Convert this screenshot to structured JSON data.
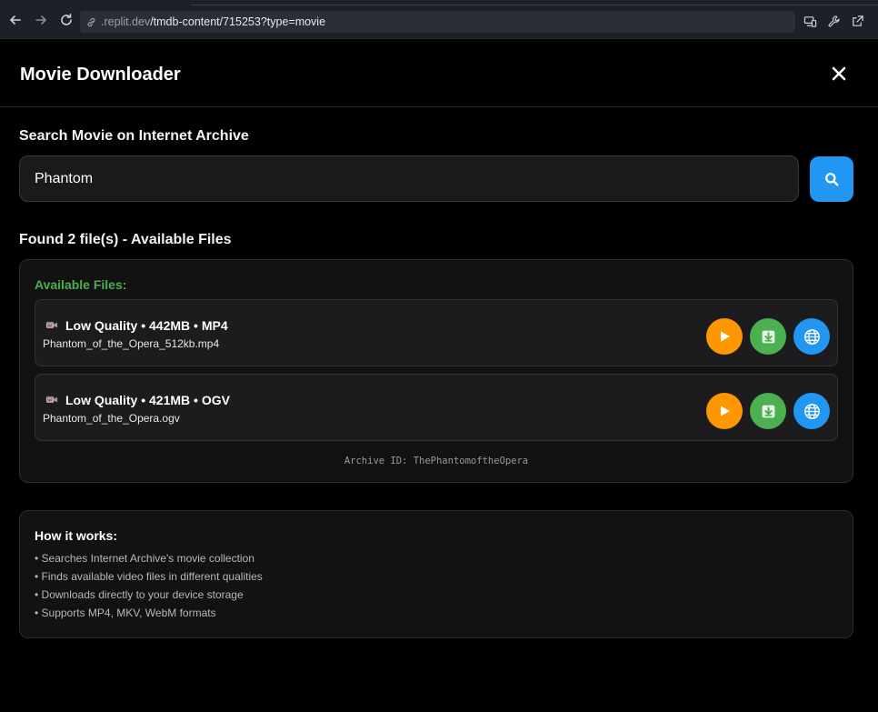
{
  "browser": {
    "url_host": ".replit.dev",
    "url_path": "/tmdb-content/715253?type=movie"
  },
  "app": {
    "title": "Movie Downloader"
  },
  "search": {
    "label": "Search Movie on Internet Archive",
    "value": "Phantom"
  },
  "results": {
    "heading": "Found 2 file(s) - Available Files",
    "available_label": "Available Files:",
    "files": [
      {
        "title": "Low Quality • 442MB • MP4",
        "filename": "Phantom_of_the_Opera_512kb.mp4"
      },
      {
        "title": "Low Quality • 421MB • OGV",
        "filename": "Phantom_of_the_Opera.ogv"
      }
    ],
    "archive_id": "Archive ID: ThePhantomoftheOpera"
  },
  "how_it_works": {
    "title": "How it works:",
    "items": [
      "• Searches Internet Archive's movie collection",
      "• Finds available video files in different qualities",
      "• Downloads directly to your device storage",
      "• Supports MP4, MKV, WebM formats"
    ]
  },
  "colors": {
    "play": "#ff9800",
    "download": "#4caf50",
    "web": "#2196f3",
    "accent_green": "#4caf50",
    "search_button": "#2196f3"
  },
  "icons": {
    "back": "arrow-left-icon",
    "forward": "arrow-right-icon",
    "reload": "reload-icon",
    "site": "link-icon",
    "close": "close-icon",
    "search": "search-icon",
    "file": "camera-icon",
    "play": "play-icon",
    "download": "download-icon",
    "web": "globe-icon"
  }
}
